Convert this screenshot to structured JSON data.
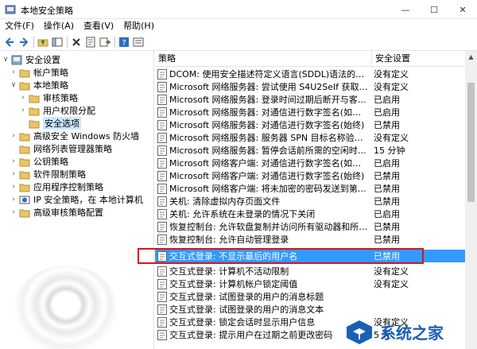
{
  "window": {
    "title": "本地安全策略",
    "controls": {
      "minimize": "—",
      "maximize": "☐",
      "close": "✕"
    }
  },
  "menu": [
    "文件(F)",
    "操作(A)",
    "查看(V)",
    "帮助(H)"
  ],
  "toolbar": {
    "icons": [
      "back-icon",
      "forward-icon",
      "up-folder-icon",
      "show-hide-tree-icon",
      "delete-icon",
      "properties-icon",
      "export-list-icon",
      "help-icon",
      "details-icon"
    ]
  },
  "tree": [
    {
      "label": "安全设置",
      "indent": 0,
      "expander": "∨",
      "icon": "security-settings-icon"
    },
    {
      "label": "帐户策略",
      "indent": 1,
      "expander": "›",
      "icon": "folder-icon"
    },
    {
      "label": "本地策略",
      "indent": 1,
      "expander": "∨",
      "icon": "folder-icon"
    },
    {
      "label": "审核策略",
      "indent": 2,
      "expander": "›",
      "icon": "folder-icon"
    },
    {
      "label": "用户权限分配",
      "indent": 2,
      "expander": "›",
      "icon": "folder-icon"
    },
    {
      "label": "安全选项",
      "indent": 2,
      "expander": "",
      "icon": "folder-icon",
      "selected": true
    },
    {
      "label": "高级安全 Windows 防火墙",
      "indent": 1,
      "expander": "›",
      "icon": "folder-icon"
    },
    {
      "label": "网络列表管理器策略",
      "indent": 1,
      "expander": "",
      "icon": "folder-icon"
    },
    {
      "label": "公钥策略",
      "indent": 1,
      "expander": "›",
      "icon": "folder-icon"
    },
    {
      "label": "软件限制策略",
      "indent": 1,
      "expander": "›",
      "icon": "folder-icon"
    },
    {
      "label": "应用程序控制策略",
      "indent": 1,
      "expander": "›",
      "icon": "folder-icon"
    },
    {
      "label": "IP 安全策略，在 本地计算机",
      "indent": 1,
      "expander": "›",
      "icon": "ip-security-icon"
    },
    {
      "label": "高级审核策略配置",
      "indent": 1,
      "expander": "›",
      "icon": "folder-icon"
    }
  ],
  "list": {
    "headers": {
      "policy": "策略",
      "setting": "安全设置"
    },
    "rows": [
      {
        "name": "DCOM: 使用安全描述符定义语言(SDDL)语法的计算机启动...",
        "value": "没有定义"
      },
      {
        "name": "Microsoft 网络服务器: 尝试使用 S4U2Self 获取声明信息",
        "value": "没有定义"
      },
      {
        "name": "Microsoft 网络服务器: 登录时间过期后断开与客户端的连接",
        "value": "已启用"
      },
      {
        "name": "Microsoft 网络服务器: 对通信进行数字签名(如果客户端允...",
        "value": "已启用"
      },
      {
        "name": "Microsoft 网络服务器: 对通信进行数字签名(始终)",
        "value": "已禁用"
      },
      {
        "name": "Microsoft 网络服务器: 服务器 SPN 目标名称验证级别",
        "value": "没有定义"
      },
      {
        "name": "Microsoft 网络服务器: 暂停会话前所需的空闲时间数量",
        "value": "15 分钟"
      },
      {
        "name": "Microsoft 网络客户端: 对通信进行数字签名(如果服务器允...",
        "value": "已启用"
      },
      {
        "name": "Microsoft 网络客户端: 对通信进行数字签名(始终)",
        "value": "已禁用"
      },
      {
        "name": "Microsoft 网络客户端: 将未加密的密码发送到第三方 SMB...",
        "value": "已禁用"
      },
      {
        "name": "关机: 清除虚拟内存页面文件",
        "value": "已禁用"
      },
      {
        "name": "关机: 允许系统在未登录的情况下关闭",
        "value": "已启用"
      },
      {
        "name": "恢复控制台: 允许软盘复制并访问所有驱动器和所有文件夹",
        "value": "已禁用"
      },
      {
        "name": "恢复控制台: 允许自动管理登录",
        "value": "已禁用"
      },
      {
        "name": "交互式登录: 不显示最后的用户名",
        "value": "已禁用",
        "selected": true
      },
      {
        "name": "交互式登录: 计算机不活动限制",
        "value": "没有定义"
      },
      {
        "name": "交互式登录: 计算机帐户锁定阈值",
        "value": "没有定义"
      },
      {
        "name": "交互式登录: 试图登录的用户的消息标题",
        "value": ""
      },
      {
        "name": "交互式登录: 试图登录的用户的消息文本",
        "value": ""
      },
      {
        "name": "交互式登录: 锁定会话时显示用户信息",
        "value": "没有定义"
      },
      {
        "name": "交互式登录: 提示用户在过期之前更改密码",
        "value": "5 天"
      }
    ]
  },
  "watermark": {
    "text": "系统之家"
  },
  "colors": {
    "selection": "#3399ff",
    "tree_selection": "#cce8ff",
    "highlight_border": "#d9141b",
    "watermark": "#1a5fb4"
  }
}
